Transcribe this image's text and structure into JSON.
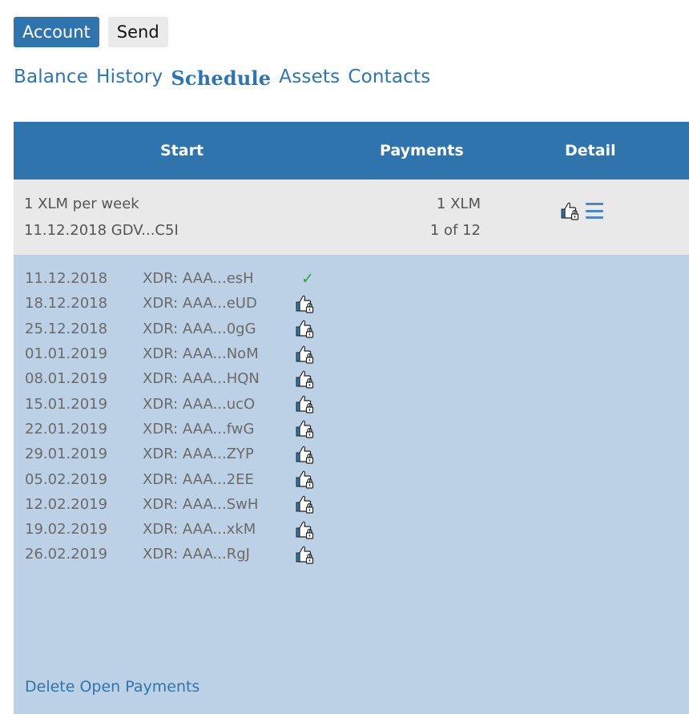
{
  "top_tabs": [
    {
      "label": "Account",
      "active": true
    },
    {
      "label": "Send",
      "active": false
    }
  ],
  "sub_nav": [
    {
      "label": "Balance",
      "active": false
    },
    {
      "label": "History",
      "active": false
    },
    {
      "label": "Schedule",
      "active": true
    },
    {
      "label": "Assets",
      "active": false
    },
    {
      "label": "Contacts",
      "active": false
    }
  ],
  "table": {
    "headers": {
      "start": "Start",
      "payments": "Payments",
      "detail": "Detail"
    },
    "summary": {
      "start_line1": "1 XLM per week",
      "start_line2": "11.12.2018 GDV...C5I",
      "payments_line1": "1 XLM",
      "payments_line2": "1 of 12",
      "icons": [
        "thumbs-up-lock-icon",
        "menu-icon"
      ]
    },
    "rows": [
      {
        "date": "11.12.2018",
        "xdr": "XDR: AAA...esH",
        "status": "check"
      },
      {
        "date": "18.12.2018",
        "xdr": "XDR: AAA...eUD",
        "status": "locked"
      },
      {
        "date": "25.12.2018",
        "xdr": "XDR: AAA...0gG",
        "status": "locked"
      },
      {
        "date": "01.01.2019",
        "xdr": "XDR: AAA...NoM",
        "status": "locked"
      },
      {
        "date": "08.01.2019",
        "xdr": "XDR: AAA...HQN",
        "status": "locked"
      },
      {
        "date": "15.01.2019",
        "xdr": "XDR: AAA...ucO",
        "status": "locked"
      },
      {
        "date": "22.01.2019",
        "xdr": "XDR: AAA...fwG",
        "status": "locked"
      },
      {
        "date": "29.01.2019",
        "xdr": "XDR: AAA...ZYP",
        "status": "locked"
      },
      {
        "date": "05.02.2019",
        "xdr": "XDR: AAA...2EE",
        "status": "locked"
      },
      {
        "date": "12.02.2019",
        "xdr": "XDR: AAA...SwH",
        "status": "locked"
      },
      {
        "date": "19.02.2019",
        "xdr": "XDR: AAA...xkM",
        "status": "locked"
      },
      {
        "date": "26.02.2019",
        "xdr": "XDR: AAA...RgJ",
        "status": "locked"
      }
    ],
    "delete_label": "Delete Open Payments"
  },
  "colors": {
    "accent": "#2f74ad",
    "summary_bg": "#e9e9e9",
    "details_bg": "#bdd1e6",
    "check": "#2aa52a"
  }
}
